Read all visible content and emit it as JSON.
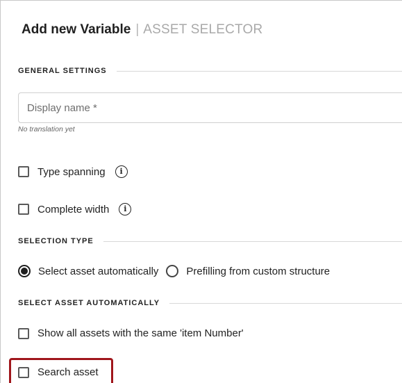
{
  "header": {
    "title": "Add new Variable",
    "separator": "|",
    "subtitle": "ASSET SELECTOR"
  },
  "general_settings": {
    "heading": "GENERAL SETTINGS",
    "display_name": {
      "placeholder": "Display name *",
      "value": "",
      "hint": "No translation yet"
    },
    "type_spanning": {
      "label": "Type spanning",
      "checked": false,
      "info_icon": "info-circle-icon"
    },
    "complete_width": {
      "label": "Complete width",
      "checked": false,
      "info_icon": "info-circle-icon"
    }
  },
  "selection_type": {
    "heading": "SELECTION TYPE",
    "options": [
      {
        "label": "Select asset automatically",
        "selected": true
      },
      {
        "label": "Prefilling from custom structure",
        "selected": false
      }
    ]
  },
  "select_asset_automatically": {
    "heading": "SELECT ASSET AUTOMATICALLY",
    "show_all": {
      "label": "Show all assets with the same 'item Number'",
      "checked": false
    },
    "search_asset": {
      "label": "Search asset",
      "checked": false
    }
  },
  "colors": {
    "highlight": "#a0161c",
    "text": "#222222",
    "muted": "#a9a9a9"
  }
}
